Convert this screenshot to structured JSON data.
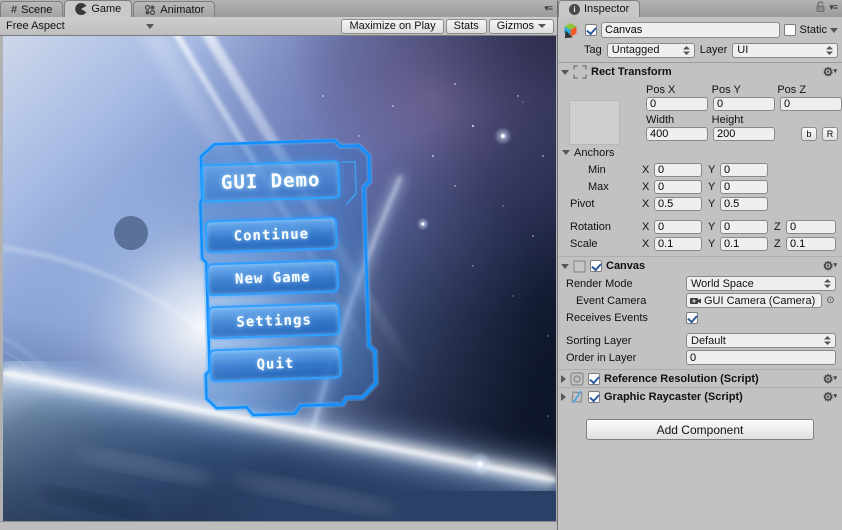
{
  "colors": {
    "accent_blue": "#1290ff",
    "panel_bg": "#c2c2c2",
    "field_bg": "#efefef",
    "space_dark": "#131a33"
  },
  "game": {
    "tabs": {
      "scene": "Scene",
      "game": "Game",
      "animator": "Animator"
    },
    "toolbar": {
      "aspect": "Free Aspect",
      "maximize": "Maximize on Play",
      "stats": "Stats",
      "gizmos": "Gizmos"
    },
    "menu": {
      "title": "GUI Demo",
      "buttons": [
        "Continue",
        "New Game",
        "Settings",
        "Quit"
      ]
    }
  },
  "inspector": {
    "tab": "Inspector",
    "gameobject": {
      "name": "Canvas",
      "static_label": "Static",
      "tag_label": "Tag",
      "tag_value": "Untagged",
      "layer_label": "Layer",
      "layer_value": "UI"
    },
    "rect_transform": {
      "title": "Rect Transform",
      "axis": {
        "x": "X",
        "y": "Y",
        "z": "Z"
      },
      "pos": {
        "x_label": "Pos X",
        "y_label": "Pos Y",
        "z_label": "Pos Z",
        "x": "0",
        "y": "0",
        "z": "0"
      },
      "size": {
        "w_label": "Width",
        "h_label": "Height",
        "w": "400",
        "h": "200",
        "blueprint_btn": "b",
        "raw_btn": "R"
      },
      "anchors": {
        "label": "Anchors",
        "min_label": "Min",
        "max_label": "Max",
        "min_x": "0",
        "min_y": "0",
        "max_x": "0",
        "max_y": "0"
      },
      "pivot": {
        "label": "Pivot",
        "x": "0.5",
        "y": "0.5"
      },
      "rotation": {
        "label": "Rotation",
        "x": "0",
        "y": "0",
        "z": "0"
      },
      "scale": {
        "label": "Scale",
        "x": "0.1",
        "y": "0.1",
        "z": "0.1"
      }
    },
    "canvas": {
      "title": "Canvas",
      "render_mode_label": "Render Mode",
      "render_mode": "World Space",
      "event_camera_label": "Event Camera",
      "event_camera": "GUI Camera (Camera)",
      "receives_events_label": "Receives Events",
      "sorting_layer_label": "Sorting Layer",
      "sorting_layer": "Default",
      "order_label": "Order in Layer",
      "order": "0"
    },
    "scripts": [
      {
        "title": "Reference Resolution (Script)"
      },
      {
        "title": "Graphic Raycaster (Script)"
      }
    ],
    "add_component": "Add Component"
  }
}
